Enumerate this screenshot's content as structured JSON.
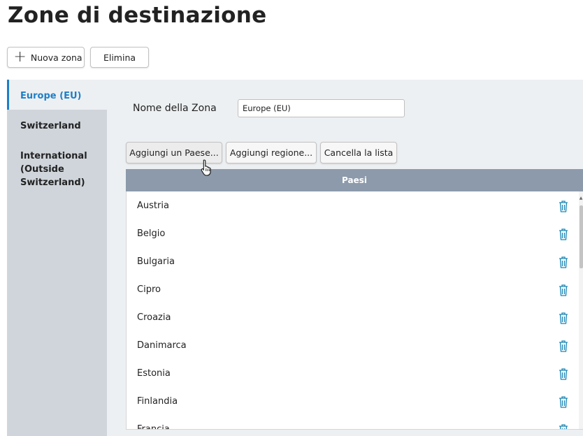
{
  "page": {
    "title": "Zone di destinazione"
  },
  "toolbar": {
    "new_zone_label": "Nuova zona",
    "delete_label": "Elimina"
  },
  "sidebar": {
    "items": [
      {
        "label": "Europe (EU)",
        "active": true
      },
      {
        "label": "Switzerland",
        "active": false
      },
      {
        "label": "International (Outside Switzerland)",
        "active": false
      }
    ]
  },
  "zone": {
    "name_label": "Nome della Zona",
    "name_value": "Europe (EU)"
  },
  "actions": {
    "add_country_label": "Aggiungi un Paese...",
    "add_region_label": "Aggiungi regione...",
    "clear_list_label": "Cancella la lista"
  },
  "countries": {
    "header": "Paesi",
    "items": [
      "Austria",
      "Belgio",
      "Bulgaria",
      "Cipro",
      "Croazia",
      "Danimarca",
      "Estonia",
      "Finlandia",
      "Francia"
    ]
  },
  "colors": {
    "accent": "#1e7fc8",
    "sidebar_bg": "#cfd5db",
    "content_bg": "#edf0f2",
    "table_header_bg": "#8c9aab",
    "trash_icon": "#1b86b5"
  },
  "icons": {
    "add": "plus-icon",
    "delete_row": "trash-icon",
    "cursor": "hand-pointer-icon"
  }
}
